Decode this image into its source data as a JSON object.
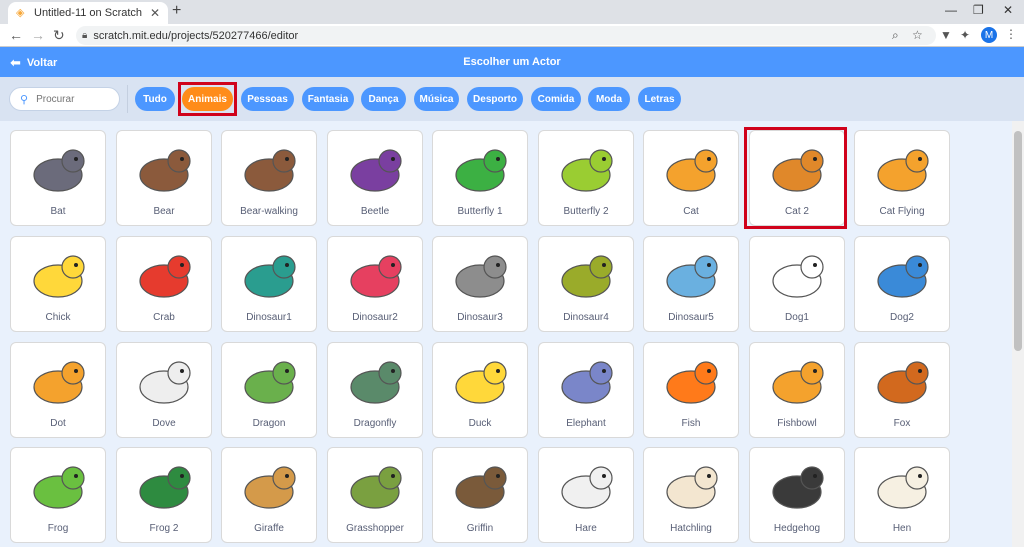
{
  "browser": {
    "tab_title": "Untitled-11 on Scratch",
    "url": "scratch.mit.edu/projects/520277466/editor",
    "avatar_letter": "M"
  },
  "header": {
    "back_label": "Voltar",
    "title": "Escolher um Actor"
  },
  "search": {
    "placeholder": "Procurar"
  },
  "tags": [
    {
      "label": "Tudo"
    },
    {
      "label": "Animais"
    },
    {
      "label": "Pessoas"
    },
    {
      "label": "Fantasia"
    },
    {
      "label": "Dança"
    },
    {
      "label": "Música"
    },
    {
      "label": "Desporto"
    },
    {
      "label": "Comida"
    },
    {
      "label": "Moda"
    },
    {
      "label": "Letras"
    }
  ],
  "active_tag": "Animais",
  "sprites": [
    {
      "name": "Bat",
      "color": "#6b6b7b"
    },
    {
      "name": "Bear",
      "color": "#8b5a3c"
    },
    {
      "name": "Bear-walking",
      "color": "#8b5a3c"
    },
    {
      "name": "Beetle",
      "color": "#7a3fa0"
    },
    {
      "name": "Butterfly 1",
      "color": "#3cb043"
    },
    {
      "name": "Butterfly 2",
      "color": "#9acd32"
    },
    {
      "name": "Cat",
      "color": "#f4a22d"
    },
    {
      "name": "Cat 2",
      "color": "#e0882a"
    },
    {
      "name": "Cat Flying",
      "color": "#f4a22d"
    },
    {
      "name": "Chick",
      "color": "#ffd83a"
    },
    {
      "name": "Crab",
      "color": "#e63b2e"
    },
    {
      "name": "Dinosaur1",
      "color": "#2a9d8f"
    },
    {
      "name": "Dinosaur2",
      "color": "#e64060"
    },
    {
      "name": "Dinosaur3",
      "color": "#8d8d8d"
    },
    {
      "name": "Dinosaur4",
      "color": "#9aab2a"
    },
    {
      "name": "Dinosaur5",
      "color": "#6ab0e0"
    },
    {
      "name": "Dog1",
      "color": "#ffffff"
    },
    {
      "name": "Dog2",
      "color": "#3a8ad8"
    },
    {
      "name": "Dot",
      "color": "#f4a22d"
    },
    {
      "name": "Dove",
      "color": "#eeeeee"
    },
    {
      "name": "Dragon",
      "color": "#6ab04c"
    },
    {
      "name": "Dragonfly",
      "color": "#5a8a6a"
    },
    {
      "name": "Duck",
      "color": "#ffd83a"
    },
    {
      "name": "Elephant",
      "color": "#7a86c9"
    },
    {
      "name": "Fish",
      "color": "#ff7a1a"
    },
    {
      "name": "Fishbowl",
      "color": "#f4a22d"
    },
    {
      "name": "Fox",
      "color": "#d2691e"
    },
    {
      "name": "Frog",
      "color": "#6ac040"
    },
    {
      "name": "Frog 2",
      "color": "#2e8b40"
    },
    {
      "name": "Giraffe",
      "color": "#d49a4a"
    },
    {
      "name": "Grasshopper",
      "color": "#7aa040"
    },
    {
      "name": "Griffin",
      "color": "#7a5a3a"
    },
    {
      "name": "Hare",
      "color": "#f0f0f0"
    },
    {
      "name": "Hatchling",
      "color": "#f3e6d0"
    },
    {
      "name": "Hedgehog",
      "color": "#3a3a3a"
    },
    {
      "name": "Hen",
      "color": "#f6f0e2"
    }
  ],
  "highlighted_sprite": "Cat 2"
}
